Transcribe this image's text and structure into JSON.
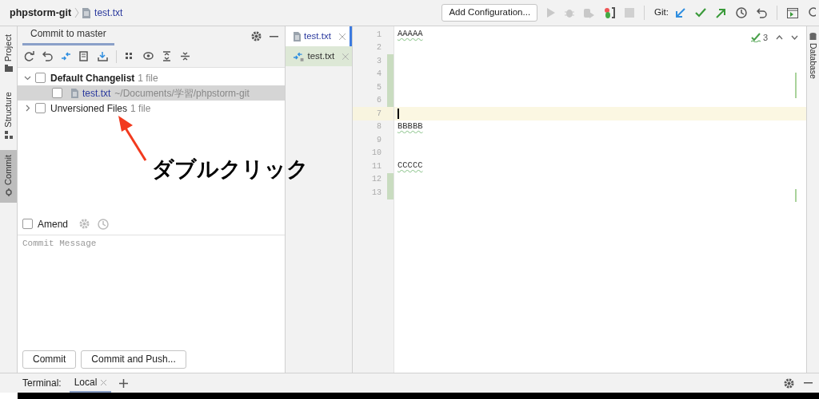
{
  "breadcrumb": {
    "project": "phpstorm-git",
    "file": "test.txt"
  },
  "toolbar": {
    "config_button": "Add Configuration...",
    "git_label": "Git:"
  },
  "left_stripe": [
    {
      "label": "Project",
      "selected": false
    },
    {
      "label": "Structure",
      "selected": false
    },
    {
      "label": "Commit",
      "selected": true
    }
  ],
  "commit_panel": {
    "tab": "Commit to master",
    "tree": [
      {
        "kind": "changelist",
        "label": "Default Changelist",
        "count": "1 file",
        "checked": false,
        "expanded": true,
        "selected": false,
        "children": [
          {
            "label": "test.txt",
            "path": "~/Documents/学習/phpstorm-git",
            "checked": false,
            "selected": true
          }
        ]
      },
      {
        "kind": "unversioned",
        "label": "Unversioned Files",
        "count": "1 file",
        "checked": false,
        "expanded": false,
        "selected": false
      }
    ],
    "amend": {
      "label": "Amend",
      "checked": false
    },
    "commit_message": {
      "placeholder": "Commit Message"
    },
    "buttons": [
      "Commit",
      "Commit and Push..."
    ]
  },
  "editor_tabs": [
    {
      "kind": "file",
      "label": "test.txt",
      "selected": true
    },
    {
      "kind": "diff",
      "label": "test.txt",
      "selected": false
    }
  ],
  "editor": {
    "inspection_count": "3",
    "lines": [
      {
        "number": "1",
        "text": "AAAAA",
        "changed": false,
        "current": false
      },
      {
        "number": "2",
        "changed": false,
        "current": false
      },
      {
        "number": "3",
        "changed": true,
        "current": false
      },
      {
        "number": "4",
        "changed": true,
        "current": false
      },
      {
        "number": "5",
        "changed": true,
        "current": false
      },
      {
        "number": "6",
        "changed": true,
        "current": false
      },
      {
        "number": "7",
        "changed": false,
        "current": true
      },
      {
        "number": "8",
        "text": "BBBBB",
        "changed": false,
        "current": false
      },
      {
        "number": "9",
        "changed": false,
        "current": false
      },
      {
        "number": "10",
        "changed": false,
        "current": false
      },
      {
        "number": "11",
        "text": "CCCCC",
        "changed": false,
        "current": false
      },
      {
        "number": "12",
        "changed": true,
        "current": false
      },
      {
        "number": "13",
        "changed": true,
        "current": false
      }
    ]
  },
  "right_stripe": [
    {
      "label": "Database"
    }
  ],
  "terminal": {
    "title": "Terminal:",
    "tabs": [
      {
        "label": "Local",
        "selected": true
      }
    ]
  },
  "annotation": {
    "text": "ダブルクリック"
  }
}
